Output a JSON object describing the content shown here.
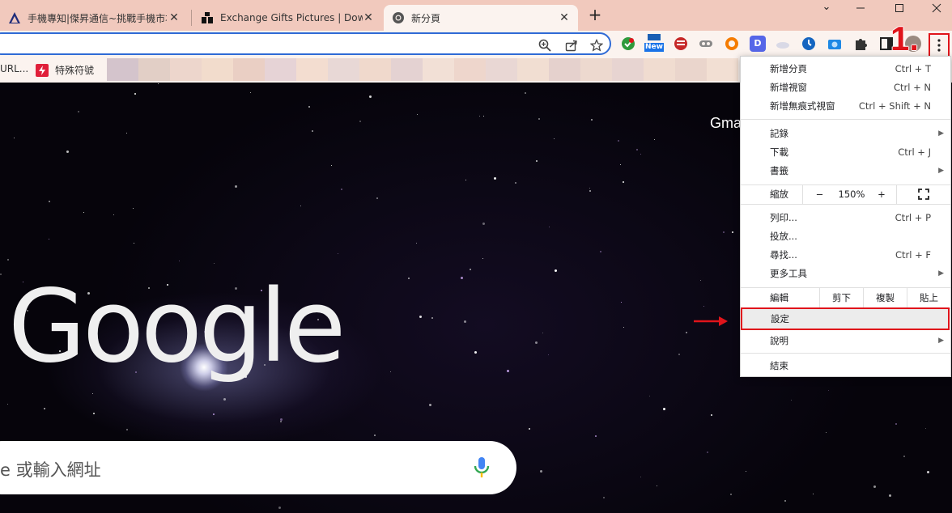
{
  "tabs": [
    {
      "title": "手機專知|傑昇通信~挑戰手機市場最低價",
      "active": false
    },
    {
      "title": "Exchange Gifts Pictures | Download",
      "active": false
    },
    {
      "title": "新分頁",
      "active": true
    }
  ],
  "window_controls": {
    "minimize": "⌄",
    "maximize": "☐",
    "close": "✕",
    "chevron": "⌄"
  },
  "new_tab_label": "+",
  "toolbar": {
    "new_badge": "New",
    "d_badge": "D"
  },
  "annotations": {
    "step": "1."
  },
  "bookmarks": [
    {
      "label": "URL..."
    },
    {
      "label": "特殊符號"
    }
  ],
  "page": {
    "gmail_label": "Gma",
    "logo_text": "Google",
    "search_placeholder": "e 或輸入網址"
  },
  "menu": {
    "group1": [
      {
        "label": "新增分頁",
        "shortcut": "Ctrl + T"
      },
      {
        "label": "新增視窗",
        "shortcut": "Ctrl + N"
      },
      {
        "label": "新增無痕式視窗",
        "shortcut": "Ctrl + Shift + N"
      }
    ],
    "group2": [
      {
        "label": "記錄",
        "shortcut": "",
        "submenu": true
      },
      {
        "label": "下載",
        "shortcut": "Ctrl + J"
      },
      {
        "label": "書籤",
        "shortcut": "",
        "submenu": true
      }
    ],
    "zoom": {
      "label": "縮放",
      "minus": "−",
      "value": "150%",
      "plus": "+",
      "fullscreen": "⛶"
    },
    "group3": [
      {
        "label": "列印...",
        "shortcut": "Ctrl + P"
      },
      {
        "label": "投放...",
        "shortcut": ""
      },
      {
        "label": "尋找...",
        "shortcut": "Ctrl + F"
      },
      {
        "label": "更多工具",
        "shortcut": "",
        "submenu": true
      }
    ],
    "edit": {
      "label": "編輯",
      "cut": "剪下",
      "copy": "複製",
      "paste": "貼上"
    },
    "settings": {
      "label": "設定"
    },
    "help": {
      "label": "說明",
      "submenu": true
    },
    "exit": {
      "label": "結束"
    }
  },
  "colors": {
    "accent_red": "#e0141b",
    "tabstrip": "#f1c9bd",
    "toolbar": "#fbf3ef",
    "omnibox_border": "#2f6bd6"
  }
}
